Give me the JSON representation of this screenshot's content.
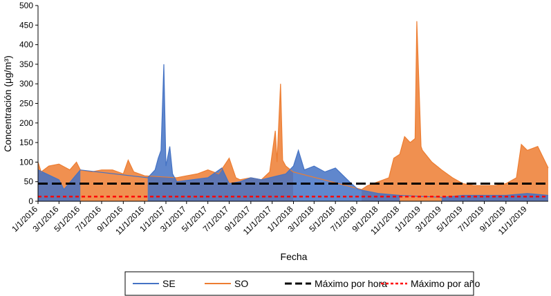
{
  "chart_data": {
    "type": "line",
    "title": "",
    "xlabel": "Fecha",
    "ylabel": "Concentración (μg/m³)",
    "ylim": [
      0,
      500
    ],
    "yticks": [
      0,
      50,
      100,
      150,
      200,
      250,
      300,
      350,
      400,
      450,
      500
    ],
    "xlim": [
      "1/1/2016",
      "12/31/2019"
    ],
    "xtick_labels": [
      "1/1/2016",
      "3/1/2016",
      "5/1/2016",
      "7/1/2016",
      "9/1/2016",
      "11/1/2016",
      "1/1/2017",
      "3/1/2017",
      "5/1/2017",
      "7/1/2017",
      "9/1/2017",
      "11/1/2017",
      "1/1/2018",
      "3/1/2018",
      "5/1/2018",
      "7/1/2018",
      "9/1/2018",
      "11/1/2018",
      "1/1/2019",
      "3/1/2019",
      "5/1/2019",
      "7/1/2019",
      "9/1/2019",
      "11/1/2019"
    ],
    "grid": false,
    "legend_position": "bottom",
    "series": [
      {
        "name": "SE",
        "color": "#4472C4",
        "style": "solid",
        "x": [
          "1/1/2016",
          "3/1/2016",
          "3/15/2016",
          "5/1/2016",
          "11/10/2016",
          "12/1/2016",
          "12/10/2016",
          "12/18/2016",
          "12/26/2016",
          "1/1/2017",
          "1/12/2017",
          "1/20/2017",
          "2/1/2017",
          "5/1/2017",
          "6/10/2017",
          "7/1/2017",
          "8/1/2017",
          "9/1/2017",
          "10/1/2017",
          "12/10/2017",
          "1/1/2018",
          "1/15/2018",
          "2/1/2018",
          "3/1/2018",
          "4/1/2018",
          "5/1/2018",
          "6/10/2018",
          "7/5/2018",
          "9/1/2018",
          "11/1/2018",
          "3/1/2019",
          "5/1/2019",
          "7/1/2019",
          "9/1/2019",
          "11/1/2019",
          "12/31/2019"
        ],
        "y": [
          80,
          55,
          30,
          80,
          60,
          80,
          110,
          130,
          350,
          90,
          140,
          70,
          50,
          60,
          85,
          45,
          50,
          60,
          55,
          70,
          90,
          130,
          80,
          90,
          75,
          85,
          50,
          30,
          20,
          15,
          10,
          15,
          15,
          15,
          20,
          15
        ]
      },
      {
        "name": "SO",
        "color": "#ED7D31",
        "style": "solid",
        "x": [
          "1/1/2016",
          "1/10/2016",
          "2/1/2016",
          "3/1/2016",
          "4/1/2016",
          "4/20/2016",
          "5/1/2016",
          "6/1/2016",
          "7/1/2016",
          "8/1/2016",
          "9/1/2016",
          "9/15/2016",
          "10/1/2016",
          "11/1/2016",
          "2/1/2017",
          "3/1/2017",
          "4/1/2017",
          "5/1/2017",
          "6/1/2017",
          "7/1/2017",
          "7/20/2017",
          "8/1/2017",
          "9/1/2017",
          "10/1/2017",
          "10/25/2017",
          "11/10/2017",
          "11/15/2017",
          "11/25/2017",
          "12/1/2017",
          "12/10/2017",
          "12/31/2017",
          "7/15/2018",
          "8/1/2018",
          "9/1/2018",
          "10/1/2018",
          "10/15/2018",
          "11/1/2018",
          "11/15/2018",
          "12/1/2018",
          "12/15/2018",
          "12/20/2018",
          "1/1/2019",
          "1/5/2019",
          "2/1/2019",
          "3/1/2019",
          "4/1/2019",
          "5/1/2019",
          "6/1/2019",
          "7/1/2019",
          "8/1/2019",
          "9/1/2019",
          "10/1/2019",
          "10/15/2019",
          "11/1/2019",
          "12/1/2019",
          "12/31/2019"
        ],
        "y": [
          100,
          75,
          90,
          95,
          80,
          100,
          80,
          75,
          80,
          80,
          70,
          105,
          75,
          65,
          60,
          65,
          70,
          80,
          70,
          110,
          60,
          55,
          60,
          55,
          75,
          180,
          100,
          300,
          105,
          90,
          75,
          30,
          40,
          50,
          60,
          110,
          120,
          165,
          150,
          160,
          460,
          140,
          130,
          100,
          80,
          60,
          45,
          40,
          40,
          40,
          45,
          60,
          145,
          130,
          140,
          85
        ]
      },
      {
        "name": "Máximo por hora",
        "color": "#000000",
        "style": "dashed",
        "x": [
          "1/1/2016",
          "12/31/2019"
        ],
        "y": [
          45,
          45
        ]
      },
      {
        "name": "Máximo por año",
        "color": "#FF0000",
        "style": "dotted",
        "x": [
          "1/1/2016",
          "12/31/2019"
        ],
        "y": [
          12,
          12
        ]
      }
    ]
  }
}
